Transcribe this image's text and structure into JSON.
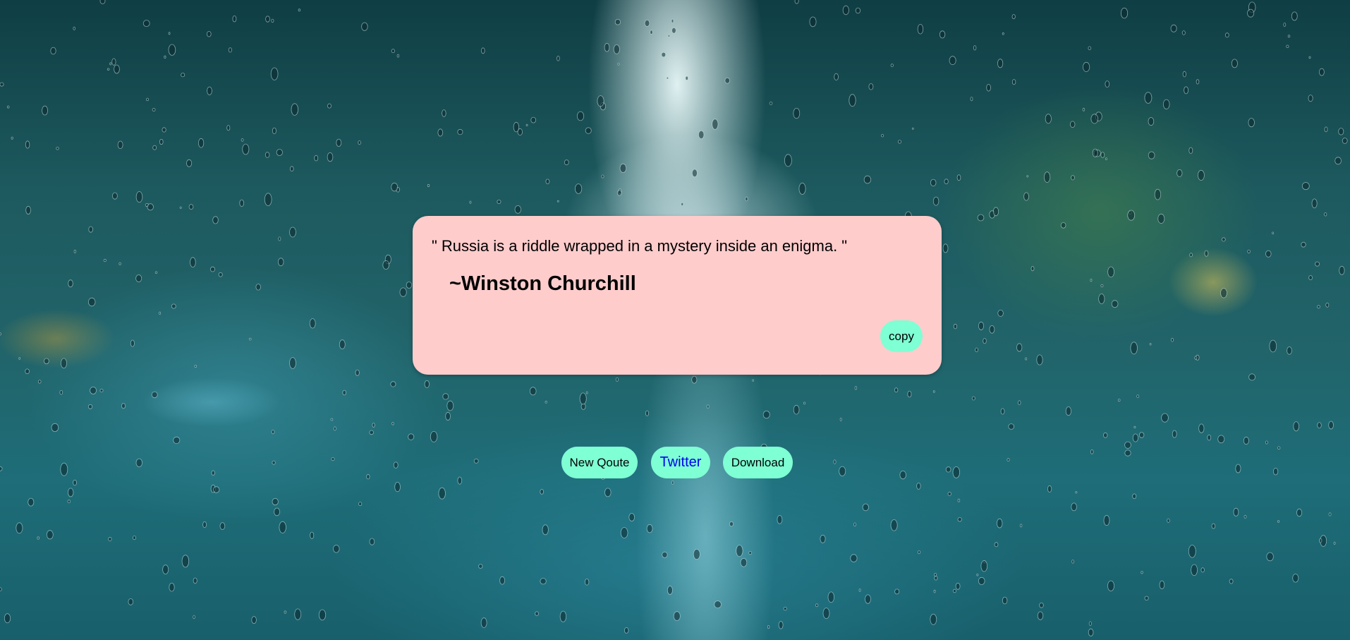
{
  "quote_card": {
    "quote_text": "\" Russia is a riddle wrapped in a mystery inside an enigma. \"",
    "author": "~Winston Churchill",
    "copy_label": "copy"
  },
  "actions": {
    "new_quote_label": "New Qoute",
    "twitter_label": "Twitter",
    "download_label": "Download"
  },
  "colors": {
    "card_background": "#ffcccc",
    "button_background": "#7fffd4",
    "link_color": "#0000ee"
  },
  "icons": {
    "background": "rainy-window-street-photo"
  }
}
